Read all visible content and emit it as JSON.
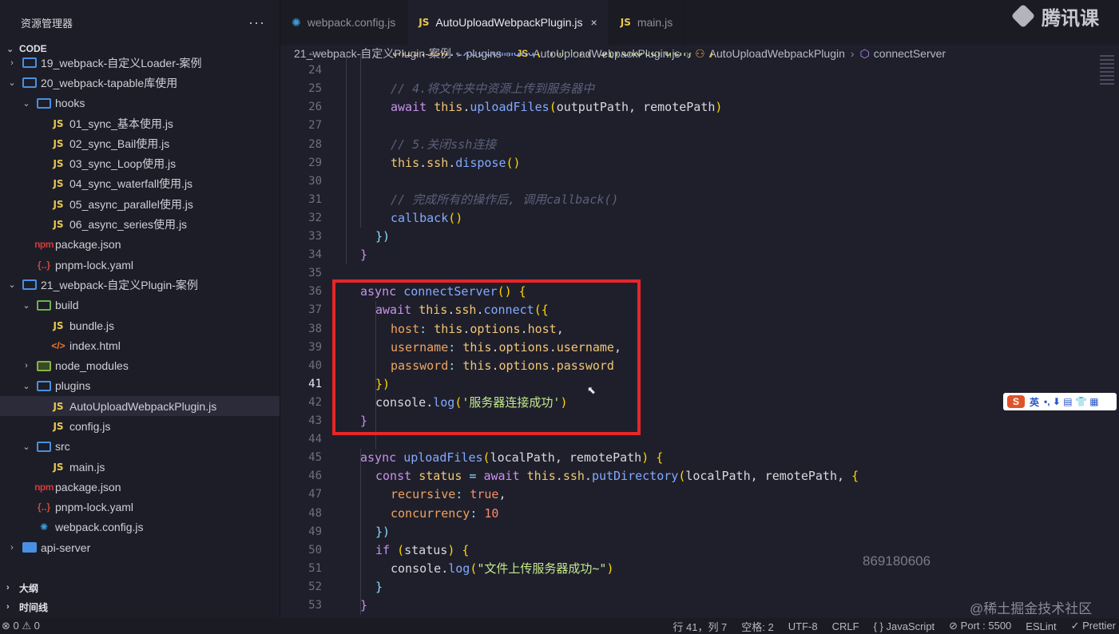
{
  "sidebar": {
    "title": "资源管理器",
    "more": "···",
    "section": "CODE",
    "tree": [
      {
        "label": "19_webpack-自定义Loader-案例",
        "kind": "folder",
        "depth": 1,
        "twist": "›"
      },
      {
        "label": "20_webpack-tapable库使用",
        "kind": "folder",
        "depth": 1,
        "twist": "⌄"
      },
      {
        "label": "hooks",
        "kind": "folder",
        "depth": 2,
        "twist": "⌄"
      },
      {
        "label": "01_sync_基本使用.js",
        "kind": "js",
        "depth": 3
      },
      {
        "label": "02_sync_Bail使用.js",
        "kind": "js",
        "depth": 3
      },
      {
        "label": "03_sync_Loop使用.js",
        "kind": "js",
        "depth": 3
      },
      {
        "label": "04_sync_waterfall使用.js",
        "kind": "js",
        "depth": 3
      },
      {
        "label": "05_async_parallel使用.js",
        "kind": "js",
        "depth": 3
      },
      {
        "label": "06_async_series使用.js",
        "kind": "js",
        "depth": 3
      },
      {
        "label": "package.json",
        "kind": "npm",
        "depth": 2
      },
      {
        "label": "pnpm-lock.yaml",
        "kind": "yaml",
        "depth": 2
      },
      {
        "label": "21_webpack-自定义Plugin-案例",
        "kind": "folder",
        "depth": 1,
        "twist": "⌄"
      },
      {
        "label": "build",
        "kind": "build",
        "depth": 2,
        "twist": "⌄"
      },
      {
        "label": "bundle.js",
        "kind": "js",
        "depth": 3
      },
      {
        "label": "index.html",
        "kind": "html",
        "depth": 3
      },
      {
        "label": "node_modules",
        "kind": "node",
        "depth": 2,
        "twist": "›"
      },
      {
        "label": "plugins",
        "kind": "folder",
        "depth": 2,
        "twist": "⌄"
      },
      {
        "label": "AutoUploadWebpackPlugin.js",
        "kind": "js",
        "depth": 3,
        "selected": true
      },
      {
        "label": "config.js",
        "kind": "js",
        "depth": 3
      },
      {
        "label": "src",
        "kind": "folder",
        "depth": 2,
        "twist": "⌄"
      },
      {
        "label": "main.js",
        "kind": "js",
        "depth": 3
      },
      {
        "label": "package.json",
        "kind": "npm",
        "depth": 2
      },
      {
        "label": "pnpm-lock.yaml",
        "kind": "yaml",
        "depth": 2
      },
      {
        "label": "webpack.config.js",
        "kind": "gear",
        "depth": 2
      },
      {
        "label": "api-server",
        "kind": "solid",
        "depth": 1,
        "twist": "›"
      }
    ],
    "outline": "大纲",
    "timeline": "时间线"
  },
  "tabs": [
    {
      "label": "webpack.config.js",
      "icon": "gear-icon",
      "active": false
    },
    {
      "label": "AutoUploadWebpackPlugin.js",
      "icon": "js-icon",
      "active": true,
      "close": "×"
    },
    {
      "label": "main.js",
      "icon": "js-icon",
      "active": false
    }
  ],
  "brand": "腾讯课",
  "breadcrumb": [
    "21_webpack-自定义Plugin-案例",
    "plugins",
    "AutoUploadWebpackPlugin.js",
    "AutoUploadWebpackPlugin",
    "connectServer"
  ],
  "code": {
    "current_line": 41,
    "lines": [
      {
        "n": 23,
        "indent": 2,
        "tokens": [
          [
            "this",
            "this"
          ],
          [
            ".",
            "plain"
          ],
          [
            "ssh",
            "this"
          ],
          [
            ".",
            "plain"
          ],
          [
            "execCommand",
            "fn"
          ],
          [
            "(",
            "brace"
          ],
          [
            "`rm -rf ${remotePath}*`",
            "str"
          ],
          [
            ")",
            "brace"
          ]
        ]
      },
      {
        "n": 24,
        "indent": 0,
        "tokens": []
      },
      {
        "n": 25,
        "indent": 2,
        "tokens": [
          [
            "// 4.将文件夹中资源上传到服务器中",
            "comment"
          ]
        ]
      },
      {
        "n": 26,
        "indent": 2,
        "tokens": [
          [
            "await ",
            "kw2"
          ],
          [
            "this",
            "this"
          ],
          [
            ".",
            "plain"
          ],
          [
            "uploadFiles",
            "fn"
          ],
          [
            "(",
            "brace"
          ],
          [
            "outputPath, remotePath",
            "plain"
          ],
          [
            ")",
            "brace"
          ]
        ]
      },
      {
        "n": 27,
        "indent": 0,
        "tokens": []
      },
      {
        "n": 28,
        "indent": 2,
        "tokens": [
          [
            "// 5.关闭ssh连接",
            "comment"
          ]
        ]
      },
      {
        "n": 29,
        "indent": 2,
        "tokens": [
          [
            "this",
            "this"
          ],
          [
            ".",
            "plain"
          ],
          [
            "ssh",
            "this"
          ],
          [
            ".",
            "plain"
          ],
          [
            "dispose",
            "fn"
          ],
          [
            "()",
            "brace"
          ]
        ]
      },
      {
        "n": 30,
        "indent": 0,
        "tokens": []
      },
      {
        "n": 31,
        "indent": 2,
        "tokens": [
          [
            "// 完成所有的操作后, 调用callback()",
            "comment"
          ]
        ]
      },
      {
        "n": 32,
        "indent": 2,
        "tokens": [
          [
            "callback",
            "fn"
          ],
          [
            "()",
            "brace"
          ]
        ]
      },
      {
        "n": 33,
        "indent": 1,
        "tokens": [
          [
            "})",
            "punct"
          ]
        ]
      },
      {
        "n": 34,
        "indent": 0,
        "tokens": [
          [
            "}",
            "kw2"
          ]
        ]
      },
      {
        "n": 35,
        "indent": 0,
        "tokens": []
      },
      {
        "n": 36,
        "indent": 0,
        "tokens": [
          [
            "async ",
            "kw2"
          ],
          [
            "connectServer",
            "fn"
          ],
          [
            "() {",
            "brace"
          ]
        ]
      },
      {
        "n": 37,
        "indent": 1,
        "tokens": [
          [
            "await ",
            "kw2"
          ],
          [
            "this",
            "this"
          ],
          [
            ".",
            "plain"
          ],
          [
            "ssh",
            "this"
          ],
          [
            ".",
            "plain"
          ],
          [
            "connect",
            "fn"
          ],
          [
            "({",
            "brace"
          ]
        ]
      },
      {
        "n": 38,
        "indent": 2,
        "tokens": [
          [
            "host",
            "prop"
          ],
          [
            ": ",
            "punct"
          ],
          [
            "this",
            "this"
          ],
          [
            ".",
            "plain"
          ],
          [
            "options",
            "this"
          ],
          [
            ".",
            "plain"
          ],
          [
            "host",
            "this"
          ],
          [
            ",",
            "plain"
          ]
        ]
      },
      {
        "n": 39,
        "indent": 2,
        "tokens": [
          [
            "username",
            "prop"
          ],
          [
            ": ",
            "punct"
          ],
          [
            "this",
            "this"
          ],
          [
            ".",
            "plain"
          ],
          [
            "options",
            "this"
          ],
          [
            ".",
            "plain"
          ],
          [
            "username",
            "this"
          ],
          [
            ",",
            "plain"
          ]
        ]
      },
      {
        "n": 40,
        "indent": 2,
        "tokens": [
          [
            "password",
            "prop"
          ],
          [
            ": ",
            "punct"
          ],
          [
            "this",
            "this"
          ],
          [
            ".",
            "plain"
          ],
          [
            "options",
            "this"
          ],
          [
            ".",
            "plain"
          ],
          [
            "password",
            "this"
          ]
        ]
      },
      {
        "n": 41,
        "indent": 1,
        "tokens": [
          [
            "})",
            "brace"
          ]
        ]
      },
      {
        "n": 42,
        "indent": 1,
        "tokens": [
          [
            "console",
            "plain"
          ],
          [
            ".",
            "plain"
          ],
          [
            "log",
            "fn"
          ],
          [
            "(",
            "brace"
          ],
          [
            "'服务器连接成功'",
            "str"
          ],
          [
            ")",
            "brace"
          ]
        ]
      },
      {
        "n": 43,
        "indent": 0,
        "tokens": [
          [
            "}",
            "kw2"
          ]
        ]
      },
      {
        "n": 44,
        "indent": 0,
        "tokens": []
      },
      {
        "n": 45,
        "indent": 0,
        "tokens": [
          [
            "async ",
            "kw2"
          ],
          [
            "uploadFiles",
            "fn"
          ],
          [
            "(",
            "brace"
          ],
          [
            "localPath, remotePath",
            "plain"
          ],
          [
            ") {",
            "brace"
          ]
        ]
      },
      {
        "n": 46,
        "indent": 1,
        "tokens": [
          [
            "const ",
            "kw2"
          ],
          [
            "status ",
            "this"
          ],
          [
            "= ",
            "punct"
          ],
          [
            "await ",
            "kw2"
          ],
          [
            "this",
            "this"
          ],
          [
            ".",
            "plain"
          ],
          [
            "ssh",
            "this"
          ],
          [
            ".",
            "plain"
          ],
          [
            "putDirectory",
            "fn"
          ],
          [
            "(",
            "brace"
          ],
          [
            "localPath, remotePath, ",
            "plain"
          ],
          [
            "{",
            "brace"
          ]
        ]
      },
      {
        "n": 47,
        "indent": 2,
        "tokens": [
          [
            "recursive",
            "prop"
          ],
          [
            ": ",
            "punct"
          ],
          [
            "true",
            "num"
          ],
          [
            ",",
            "plain"
          ]
        ]
      },
      {
        "n": 48,
        "indent": 2,
        "tokens": [
          [
            "concurrency",
            "prop"
          ],
          [
            ": ",
            "punct"
          ],
          [
            "10",
            "num"
          ]
        ]
      },
      {
        "n": 49,
        "indent": 1,
        "tokens": [
          [
            "})",
            "punct"
          ]
        ]
      },
      {
        "n": 50,
        "indent": 1,
        "tokens": [
          [
            "if ",
            "kw2"
          ],
          [
            "(",
            "brace"
          ],
          [
            "status",
            "plain"
          ],
          [
            ") {",
            "brace"
          ]
        ]
      },
      {
        "n": 51,
        "indent": 2,
        "tokens": [
          [
            "console",
            "plain"
          ],
          [
            ".",
            "plain"
          ],
          [
            "log",
            "fn"
          ],
          [
            "(",
            "brace"
          ],
          [
            "\"文件上传服务器成功~\"",
            "str"
          ],
          [
            ")",
            "brace"
          ]
        ]
      },
      {
        "n": 52,
        "indent": 1,
        "tokens": [
          [
            "}",
            "punct"
          ]
        ]
      },
      {
        "n": 53,
        "indent": 0,
        "tokens": [
          [
            "}",
            "kw2"
          ]
        ]
      }
    ]
  },
  "ime": {
    "logo": "S",
    "lang": "英",
    "icons": "•, ⬇ ▤ 👕 ▦"
  },
  "watermark_number": "869180606",
  "watermark_site": "@稀土掘金技术社区",
  "status": {
    "problems": "⊗ 0 ⚠ 0",
    "position": "行 41，列 7",
    "spaces": "空格: 2",
    "encoding": "UTF-8",
    "eol": "CRLF",
    "language": "{ } JavaScript",
    "port": "⊘ Port : 5500",
    "eslint": "ESLint",
    "prettier": "✓ Prettier"
  }
}
